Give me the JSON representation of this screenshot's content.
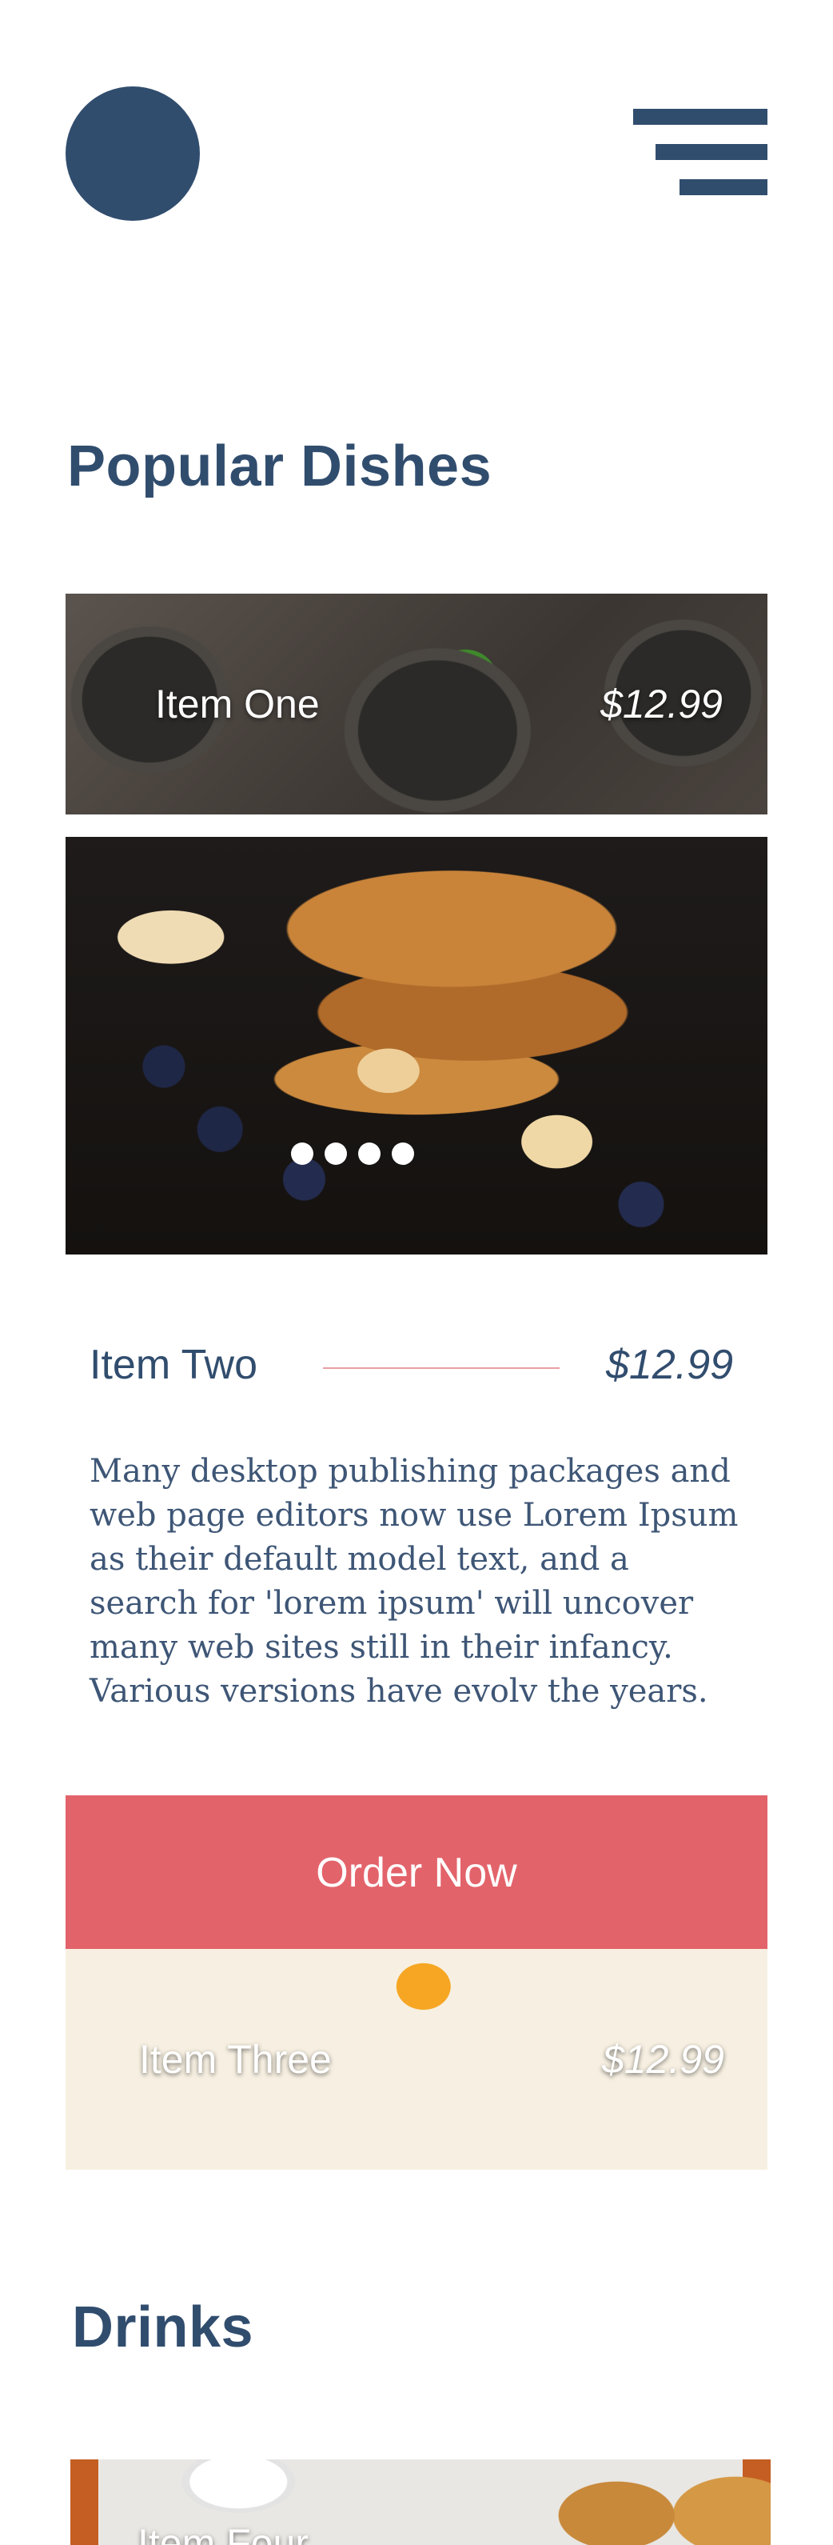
{
  "header": {
    "logo_icon": "logo-circle",
    "menu_icon": "hamburger-menu-icon"
  },
  "sections": {
    "popular_title": "Popular Dishes",
    "drinks_title": "Drinks"
  },
  "popular": {
    "item_one": {
      "name": "Item One",
      "price": "$12.99"
    },
    "item_two": {
      "name": "Item Two",
      "price": "$12.99",
      "description": "Many desktop publishing packages and web page editors now use Lorem Ipsum as their default model text, and a search for 'lorem ipsum' will uncover many web sites still in their infancy. Various versions have evolv the years."
    },
    "carousel_dots": 4,
    "order_label": "Order Now",
    "item_three": {
      "name": "Item Three",
      "price": "$12.99"
    }
  },
  "drinks": {
    "item_four": {
      "name": "Item Four"
    }
  },
  "colors": {
    "primary": "#314d6e",
    "accent": "#e3636b",
    "background": "#ffffff"
  }
}
